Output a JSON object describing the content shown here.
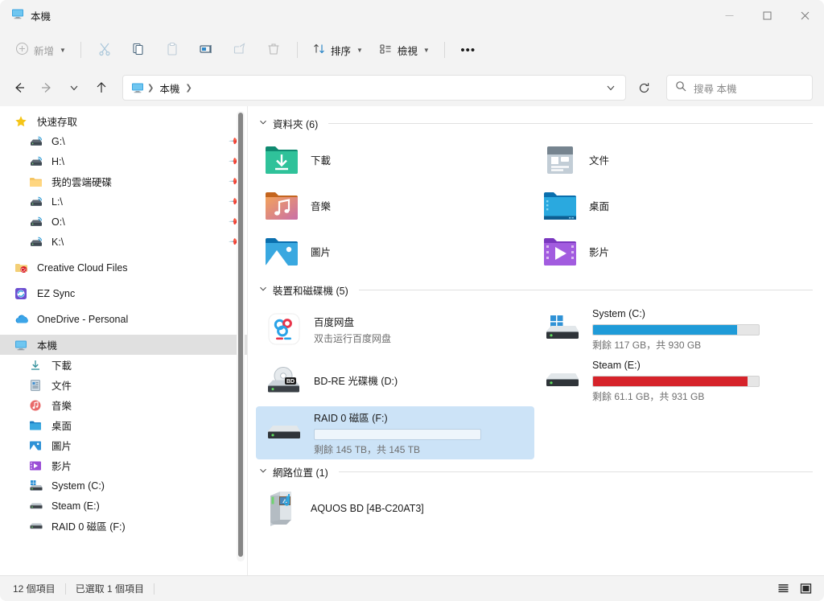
{
  "window": {
    "title": "本機",
    "title_icon": "this-pc-icon",
    "controls": {
      "minimize": "─",
      "maximize": "□",
      "close": "✕"
    }
  },
  "toolbar": {
    "new_label": "新增",
    "new_icon": "plus-circle-icon",
    "cut_icon": "scissors-icon",
    "copy_icon": "copy-icon",
    "paste_icon": "clipboard-icon",
    "rename_icon": "rename-icon",
    "share_icon": "share-icon",
    "delete_icon": "trash-icon",
    "sort_label": "排序",
    "sort_icon": "sort-arrows-icon",
    "view_label": "檢視",
    "view_icon": "view-list-icon",
    "more_label": "•••"
  },
  "nav": {
    "back_icon": "arrow-left-icon",
    "forward_icon": "arrow-right-icon",
    "recent_icon": "chevron-down-icon",
    "up_icon": "arrow-up-icon",
    "breadcrumb_icon": "this-pc-icon",
    "breadcrumb": [
      "本機"
    ],
    "dropdown_icon": "chevron-down-icon",
    "refresh_icon": "refresh-icon"
  },
  "search": {
    "icon": "search-icon",
    "placeholder": "搜尋 本機"
  },
  "sidebar": {
    "groups": [
      {
        "header": {
          "label": "快速存取",
          "icon": "star-icon"
        },
        "items": [
          {
            "label": "G:\\",
            "icon": "network-drive-icon",
            "pinned": true
          },
          {
            "label": "H:\\",
            "icon": "network-drive-icon",
            "pinned": true
          },
          {
            "label": "我的雲端硬碟",
            "icon": "folder-icon",
            "pinned": true
          },
          {
            "label": "L:\\",
            "icon": "network-drive-icon",
            "pinned": true
          },
          {
            "label": "O:\\",
            "icon": "network-drive-icon",
            "pinned": true
          },
          {
            "label": "K:\\",
            "icon": "network-drive-icon",
            "pinned": true
          }
        ]
      }
    ],
    "standalone": [
      {
        "label": "Creative Cloud Files",
        "icon": "creative-cloud-icon"
      },
      {
        "label": "EZ Sync",
        "icon": "ez-sync-icon"
      },
      {
        "label": "OneDrive - Personal",
        "icon": "onedrive-icon"
      }
    ],
    "this_pc": {
      "label": "本機",
      "icon": "this-pc-icon",
      "selected": true
    },
    "this_pc_children": [
      {
        "label": "下載",
        "icon": "downloads-icon"
      },
      {
        "label": "文件",
        "icon": "documents-icon"
      },
      {
        "label": "音樂",
        "icon": "music-icon"
      },
      {
        "label": "桌面",
        "icon": "desktop-icon"
      },
      {
        "label": "圖片",
        "icon": "pictures-icon"
      },
      {
        "label": "影片",
        "icon": "videos-icon"
      },
      {
        "label": "System (C:)",
        "icon": "windows-drive-icon"
      },
      {
        "label": "Steam (E:)",
        "icon": "hard-drive-icon"
      },
      {
        "label": "RAID 0 磁區 (F:)",
        "icon": "hard-drive-icon"
      }
    ]
  },
  "content": {
    "folders_group": {
      "title": "資料夾 (6)",
      "chevron": "⌄"
    },
    "folders": [
      {
        "name": "下載",
        "icon": "downloads-folder-icon"
      },
      {
        "name": "文件",
        "icon": "documents-folder-icon"
      },
      {
        "name": "音樂",
        "icon": "music-folder-icon"
      },
      {
        "name": "桌面",
        "icon": "desktop-folder-icon"
      },
      {
        "name": "圖片",
        "icon": "pictures-folder-icon"
      },
      {
        "name": "影片",
        "icon": "videos-folder-icon"
      }
    ],
    "drives_group": {
      "title": "裝置和磁碟機 (5)",
      "chevron": "⌄"
    },
    "drives": [
      {
        "name": "百度网盘",
        "subtitle": "双击运行百度网盘",
        "icon": "baidu-netdisk-icon",
        "has_bar": false,
        "selected": false
      },
      {
        "name": "System (C:)",
        "subtitle": "剩餘 117 GB，共 930 GB",
        "icon": "windows-drive-icon",
        "has_bar": true,
        "used_percent": 87,
        "bar_color": "#1f9bd8",
        "free_gb": 117,
        "total_gb": 930,
        "selected": false
      },
      {
        "name": "BD-RE 光碟機 (D:)",
        "subtitle": "",
        "icon": "bd-drive-icon",
        "has_bar": false,
        "selected": false
      },
      {
        "name": "Steam (E:)",
        "subtitle": "剩餘 61.1 GB，共 931 GB",
        "icon": "hard-drive-icon",
        "has_bar": true,
        "used_percent": 93,
        "bar_color": "#d6232a",
        "free_gb": 61.1,
        "total_gb": 931,
        "selected": false
      },
      {
        "name": "RAID 0 磁區 (F:)",
        "subtitle": "剩餘 145 TB，共 145 TB",
        "icon": "hard-drive-icon",
        "has_bar": true,
        "used_percent": 0,
        "bar_color": "#1f9bd8",
        "free_gb": "145 TB",
        "total_gb": "145 TB",
        "selected": true
      }
    ],
    "network_group": {
      "title": "網路位置 (1)",
      "chevron": "⌄"
    },
    "network": [
      {
        "name": "AQUOS BD [4B-C20AT3]",
        "icon": "media-server-icon"
      }
    ]
  },
  "statusbar": {
    "item_count": "12 個項目",
    "selection": "已選取 1 個項目",
    "list_view_icon": "list-view-icon",
    "tile_view_icon": "tile-view-icon"
  },
  "colors": {
    "accent_blue": "#1f9bd8",
    "warning_red": "#d6232a",
    "selection_blue": "#cce3f7",
    "sidebar_selected": "#e0e0e0"
  }
}
